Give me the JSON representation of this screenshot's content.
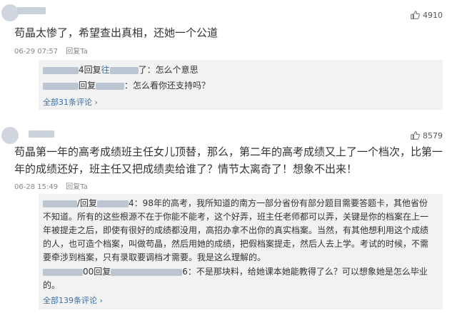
{
  "comment1": {
    "likes": "4910",
    "text": "苟晶太惨了，希望查出真相，还她一个公道",
    "time": "06-29 07:57",
    "reply_label": "回复Ta",
    "replies": [
      {
        "prefix": "4回复",
        "mention": "往",
        "tail": "了：怎么个意思"
      },
      {
        "prefix": "回复",
        "mention": "",
        "tail": "：怎么看你还支持吗？"
      }
    ],
    "all_comments": "全部31条评论 ›"
  },
  "comment2": {
    "likes": "8579",
    "text": "苟晶第一年的高考成绩班主任女儿顶替，那么，第二年的高考成绩又上了一个档次，比第一年的成绩还好，班主任又把成绩卖给谁了？情节太离奇了！想象不出来！",
    "time": "06-28 15:49",
    "reply_label": "回复Ta",
    "reply1_prefix": "/回复",
    "reply1_tail": "4：98年的高考，我所知道的南方一部分省份有部分题目需要答题卡，其他省份不知道。所有的这些根源不在于你能不能考，这个好弄，班主任老师都可以弄，关键是你的档案在上一年被提走之后，即使有很好的成绩都没用，高招办拿不出你的真实档案。当然，有其他想利用这个成绩的人，也可造个档案，叫做苟晶，然后用她的成绩，把假档案提走，然后人去上学。考试的时候，不需要牵涉到档案，只有录取要调档才需要。我是这么理解的。",
    "reply2_prefix": "00回复",
    "reply2_tail": "6：不是那块料，给她课本她能教得了么？可以想象她是怎么毕业的。",
    "all_comments": "全部139条评论 ›"
  },
  "colors": {
    "link": "#3b6fa8",
    "reply_bg": "#f2f2f2",
    "meta": "#888888"
  },
  "icons": {
    "like": "thumbs-up-icon"
  }
}
